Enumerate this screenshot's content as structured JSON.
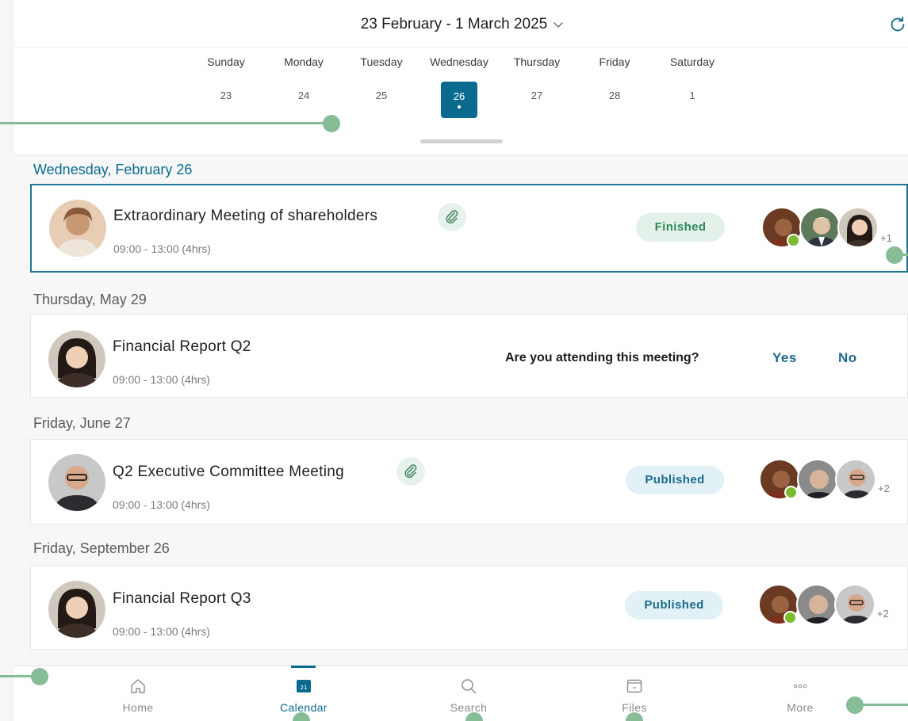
{
  "header": {
    "date_range": "23 February - 1 March 2025",
    "refresh_icon": "refresh-icon"
  },
  "week": {
    "days": [
      {
        "name": "Sunday",
        "num": "23"
      },
      {
        "name": "Monday",
        "num": "24"
      },
      {
        "name": "Tuesday",
        "num": "25"
      },
      {
        "name": "Wednesday",
        "num": "26",
        "selected": true
      },
      {
        "name": "Thursday",
        "num": "27"
      },
      {
        "name": "Friday",
        "num": "28"
      },
      {
        "name": "Saturday",
        "num": "1"
      }
    ]
  },
  "meetings": [
    {
      "date": "Wednesday, February 26",
      "title": "Extraordinary Meeting of shareholders",
      "time": "09:00 - 13:00 (4hrs)",
      "attachment": true,
      "status": "Finished",
      "extra_attendees": "+1"
    },
    {
      "date": "Thursday, May 29",
      "title": "Financial Report Q2",
      "time": "09:00 - 13:00 (4hrs)",
      "rsvp_question": "Are you attending this meeting?",
      "rsvp_yes": "Yes",
      "rsvp_no": "No"
    },
    {
      "date": "Friday, June 27",
      "title": "Q2 Executive Committee Meeting",
      "time": "09:00 - 13:00 (4hrs)",
      "attachment": true,
      "status": "Published",
      "extra_attendees": "+2"
    },
    {
      "date": "Friday, September 26",
      "title": "Financial Report Q3",
      "time": "09:00 - 13:00 (4hrs)",
      "status": "Published",
      "extra_attendees": "+2"
    }
  ],
  "tabs": [
    {
      "label": "Home",
      "icon": "home-icon"
    },
    {
      "label": "Calendar",
      "icon": "calendar-icon",
      "badge": "21",
      "active": true
    },
    {
      "label": "Search",
      "icon": "search-icon"
    },
    {
      "label": "Files",
      "icon": "folder-icon"
    },
    {
      "label": "More",
      "icon": "more-icon"
    }
  ],
  "colors": {
    "accent": "#0b6b8f",
    "finished_bg": "#e3f1ea",
    "finished_text": "#2d8a57",
    "published_bg": "#e2f1f6",
    "published_text": "#1a6a8a",
    "callout": "#86bc96",
    "check": "#7cbb2e"
  }
}
